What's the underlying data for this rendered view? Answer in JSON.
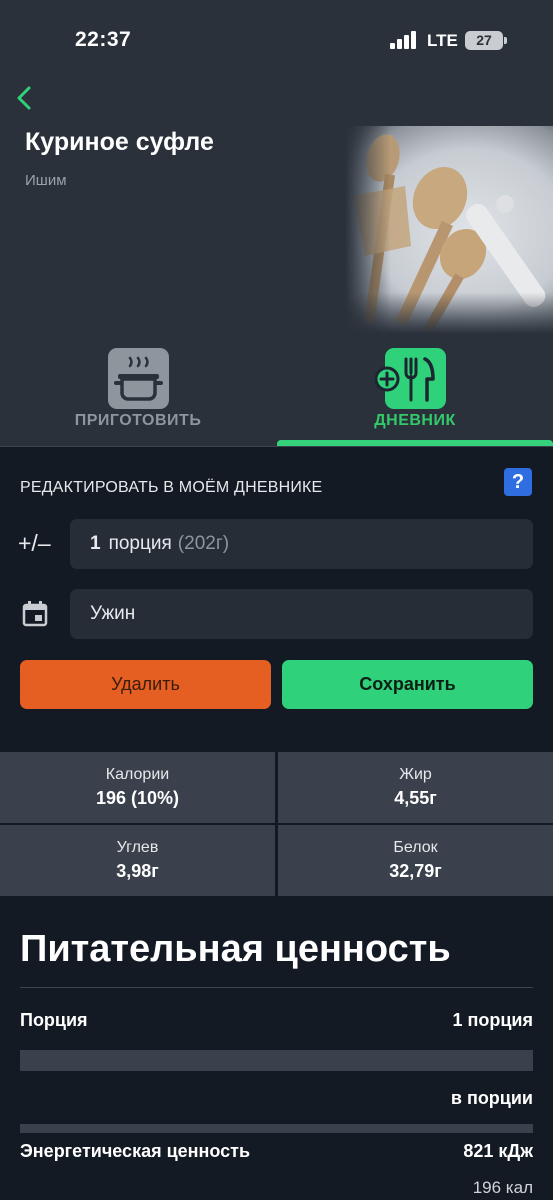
{
  "status_bar": {
    "time": "22:37",
    "network": "LTE",
    "battery": "27"
  },
  "recipe": {
    "title": "Куриное суфле",
    "subtitle": "Ишим"
  },
  "tabs": [
    {
      "label": "ПРИГОТОВИТЬ",
      "icon": "cooking-pot-icon",
      "active": false
    },
    {
      "label": "ДНЕВНИК",
      "icon": "add-to-diary-icon",
      "active": true
    }
  ],
  "edit": {
    "heading": "РЕДАКТИРОВАТЬ В МОЁМ ДНЕВНИКЕ",
    "help_label": "?",
    "plus_minus": "+/–",
    "portion_count": "1",
    "portion_unit": "порция",
    "portion_weight": "(202г)",
    "meal": "Ужин",
    "delete_label": "Удалить",
    "save_label": "Сохранить"
  },
  "summary": [
    {
      "label": "Калории",
      "value": "196 (10%)"
    },
    {
      "label": "Жир",
      "value": "4,55г"
    },
    {
      "label": "Углев",
      "value": "3,98г"
    },
    {
      "label": "Белок",
      "value": "32,79г"
    }
  ],
  "nutrition": {
    "title": "Питательная ценность",
    "portion_label": "Порция",
    "portion_value": "1 порция",
    "per_portion": "в порции",
    "energy_label": "Энергетическая ценность",
    "energy_kj": "821 кДж",
    "energy_kcal": "196 кал"
  },
  "colors": {
    "accent_green": "#2fd27a",
    "delete_orange": "#e55f22",
    "help_blue": "#2f6ee0"
  }
}
